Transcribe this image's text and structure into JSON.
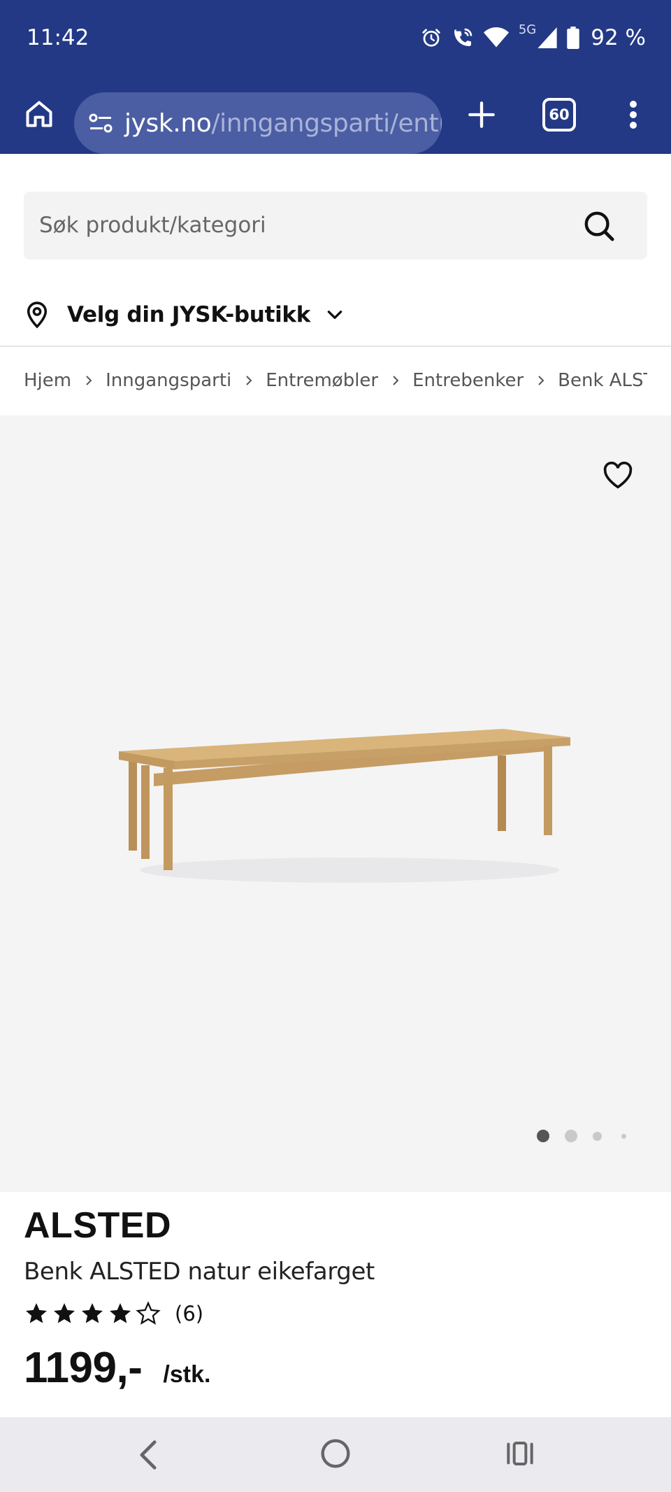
{
  "status_bar": {
    "time": "11:42",
    "network": "5G",
    "battery": "92 %",
    "icons": [
      "alarm-icon",
      "wifi-call-icon",
      "wifi-icon",
      "signal-icon",
      "battery-icon"
    ]
  },
  "browser": {
    "url_host": "jysk.no",
    "url_path": "/inngangsparti/entre",
    "tab_count": "60",
    "accent_color": "#233986"
  },
  "search": {
    "placeholder": "Søk produkt/kategori"
  },
  "store": {
    "label": "Velg din JYSK-butikk"
  },
  "breadcrumb": [
    "Hjem",
    "Inngangsparti",
    "Entremøbler",
    "Entrebenker",
    "Benk ALSTED"
  ],
  "gallery": {
    "image_count": 4,
    "active_index": 0
  },
  "product": {
    "brand": "ALSTED",
    "title": "Benk ALSTED natur eikefarget",
    "rating": 4,
    "rating_max": 5,
    "review_count": "(6)",
    "price": "1199,-",
    "unit": "/stk."
  }
}
